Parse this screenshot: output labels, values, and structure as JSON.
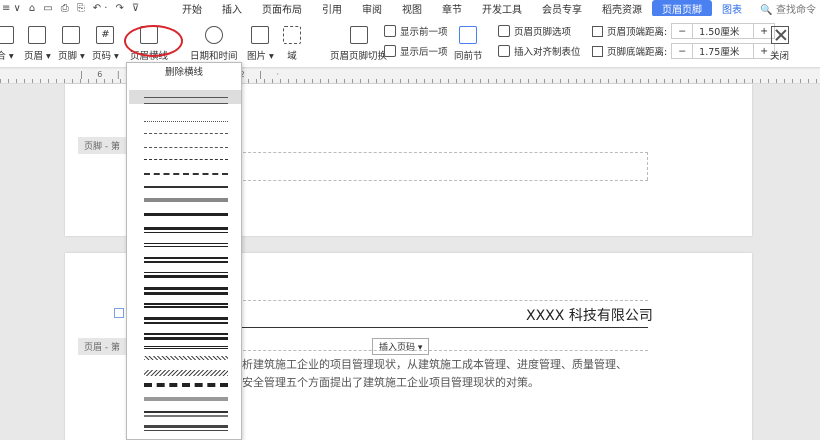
{
  "menubar": {
    "quick_access": [
      "≡ ∨",
      "⌂",
      "▭",
      "⎙",
      "⎘",
      "↶ ·",
      "↷",
      "⊽"
    ],
    "menus": [
      "开始",
      "插入",
      "页面布局",
      "引用",
      "审阅",
      "视图",
      "章节",
      "开发工具",
      "会员专享",
      "稻壳资源"
    ],
    "active_tab": "页眉页脚",
    "extra_link": "图表",
    "search_placeholder": "查找命令"
  },
  "ribbon": {
    "buttons": [
      {
        "label": "合 ▾"
      },
      {
        "label": "页眉 ▾"
      },
      {
        "label": "页脚 ▾"
      },
      {
        "label": "页码 ▾"
      },
      {
        "label": "页眉横线"
      },
      {
        "label": "日期和时间"
      },
      {
        "label": "图片 ▾"
      },
      {
        "label": "域"
      },
      {
        "label": "页眉页脚切换"
      },
      {
        "label": "同前节"
      },
      {
        "label": "关闭"
      }
    ],
    "small": [
      {
        "label": "显示前一项"
      },
      {
        "label": "显示后一项"
      },
      {
        "label": "页眉页脚选项"
      },
      {
        "label": "插入对齐制表位"
      }
    ],
    "spinners": [
      {
        "label": "页眉顶端距离:",
        "value": "1.50厘米",
        "minus": "−",
        "plus": "+"
      },
      {
        "label": "页脚底端距离:",
        "value": "1.75厘米",
        "minus": "−",
        "plus": "+"
      }
    ]
  },
  "ruler": {
    "marks": "| 6 | · | 4 | · | 2 | ·"
  },
  "dropdown": {
    "title": "删除横线",
    "line_styles": [
      "thin-selected",
      "thin",
      "dotted",
      "dashed",
      "dash-dot",
      "long-dash",
      "dash-dot-dot",
      "medium",
      "thick-gray",
      "thick",
      "thick-thin",
      "double",
      "triple",
      "thin-thick",
      "thick-thin-thick",
      "thin-thin",
      "thick-double",
      "double-thick",
      "multi",
      "wave",
      "double-wave",
      "dashed-heavy",
      "gray-bar",
      "stripes",
      "heavy-bar"
    ]
  },
  "document": {
    "footer_tag": "页脚 - 第",
    "header_tag": "页眉 - 第",
    "company": "XXXX 科技有限公司",
    "insert_page_number": "插入页码 ▾",
    "line1": "析建筑施工企业的项目管理现状，从建筑施工成本管理、进度管理、质量管理、",
    "line2": "安全管理五个方面提出了建筑施工企业项目管理现状的对策。"
  },
  "colors": {
    "accent": "#4a80f0",
    "highlight_circle": "#d8262c"
  }
}
